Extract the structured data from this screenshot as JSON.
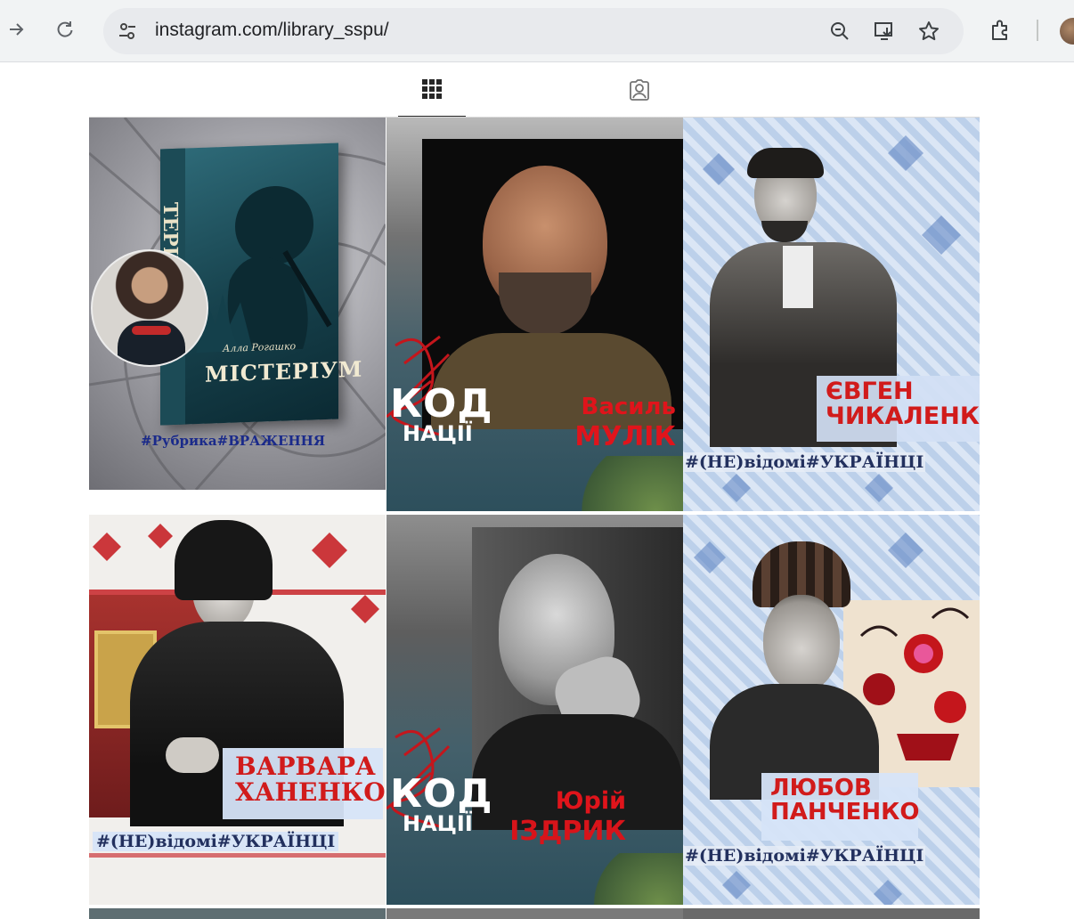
{
  "browser": {
    "url": "instagram.com/library_sspu/",
    "icons": [
      "forward-arrow-icon",
      "reload-icon",
      "site-info-icon",
      "zoom-icon",
      "install-app-icon",
      "bookmark-star-icon",
      "extensions-icon",
      "profile-avatar"
    ]
  },
  "tabs": [
    {
      "name": "posts",
      "icon": "grid-icon",
      "active": true
    },
    {
      "name": "tagged",
      "icon": "tagged-person-icon",
      "active": false
    }
  ],
  "posts": [
    {
      "tag": "#Рубрика#ВРАЖЕННЯ",
      "book_title": "МІСТЕРІУМ",
      "book_spine": "ТЕРІУМ",
      "book_author": "Алла Рогашко"
    },
    {
      "kod_line1": "КОД",
      "kod_line2": "НАЦІЇ",
      "first_name": "Василь",
      "last_name": "МУЛІК"
    },
    {
      "first_name": "ЄВГЕН",
      "last_name": "ЧИКАЛЕНКО",
      "tag": "#(НЕ)відомі#УКРАЇНЦІ"
    },
    {
      "first_name": "ВАРВАРА",
      "last_name": "ХАНЕНКО",
      "tag": "#(НЕ)відомі#УКРАЇНЦІ"
    },
    {
      "kod_line1": "КОД",
      "kod_line2": "НАЦІЇ",
      "first_name": "Юрій",
      "last_name": "ІЗДРИК"
    },
    {
      "first_name": "ЛЮБОВ",
      "last_name": "ПАНЧЕНКО",
      "tag": "#(НЕ)відомі#УКРАЇНЦІ"
    }
  ],
  "colors": {
    "accent_red": "#d11b1b",
    "tag_blue": "#1a2a8a",
    "tag_navy": "#22305e"
  }
}
